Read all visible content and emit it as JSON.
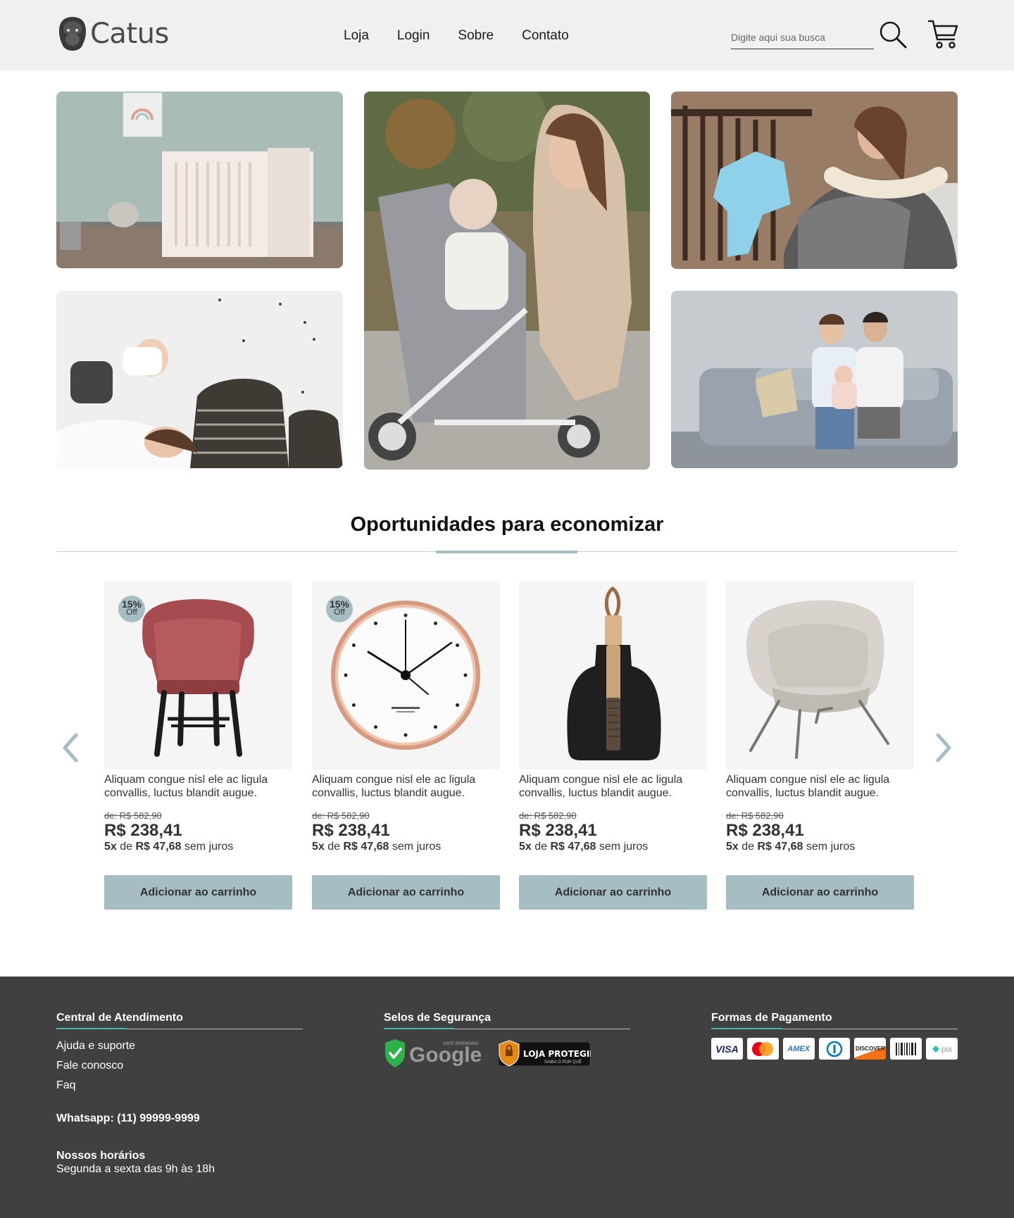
{
  "header": {
    "logo_text": "Catus",
    "nav": [
      "Loja",
      "Login",
      "Sobre",
      "Contato"
    ],
    "search_placeholder": "Digite aqui sua busca"
  },
  "section": {
    "title": "Oportunidades para economizar"
  },
  "products": [
    {
      "badge_pct": "15%",
      "badge_off": "Off",
      "desc": "Aliquam congue nisl ele ac ligula convallis, luctus blandit augue.",
      "old_price": "de: R$ 582,90",
      "price": "R$ 238,41",
      "inst_count": "5x",
      "inst_de": "de",
      "inst_value": "R$ 47,68",
      "inst_suffix": "sem juros",
      "button": "Adicionar ao carrinho"
    },
    {
      "badge_pct": "15%",
      "badge_off": "Off",
      "desc": "Aliquam congue nisl ele ac ligula convallis, luctus blandit augue.",
      "old_price": "de: R$ 582,90",
      "price": "R$ 238,41",
      "inst_count": "5x",
      "inst_de": "de",
      "inst_value": "R$ 47,68",
      "inst_suffix": "sem juros",
      "button": "Adicionar ao carrinho"
    },
    {
      "desc": "Aliquam congue nisl ele ac ligula convallis, luctus blandit augue.",
      "old_price": "de: R$ 582,90",
      "price": "R$ 238,41",
      "inst_count": "5x",
      "inst_de": "de",
      "inst_value": "R$ 47,68",
      "inst_suffix": "sem juros",
      "button": "Adicionar ao carrinho"
    },
    {
      "desc": "Aliquam congue nisl ele ac ligula convallis, luctus blandit augue.",
      "old_price": "de: R$ 582,90",
      "price": "R$ 238,41",
      "inst_count": "5x",
      "inst_de": "de",
      "inst_value": "R$ 47,68",
      "inst_suffix": "sem juros",
      "button": "Adicionar ao carrinho"
    }
  ],
  "footer": {
    "support_title": "Central de Atendimento",
    "support_links": [
      "Ajuda e suporte",
      "Fale conosco",
      "Faq"
    ],
    "whatsapp": "Whatsapp: (11) 99999-9999",
    "hours_title": "Nossos horários",
    "hours": "Segunda a sexta das 9h às 18h",
    "security_title": "Selos de Segurança",
    "google_seal_small": "SAFE BROWSING",
    "google_seal_text": "Google",
    "loja_seal_text": "LOJA PROTEGIDA",
    "loja_seal_small": "SAIBA O POR QUÊ",
    "payment_title": "Formas de Pagamento",
    "payments": [
      "VISA",
      "AMEX",
      "DISCOVER",
      "pix"
    ]
  },
  "colors": {
    "accent": "#a6bec3",
    "footer_bg": "#404040",
    "footer_accent": "#4fb7b0"
  }
}
